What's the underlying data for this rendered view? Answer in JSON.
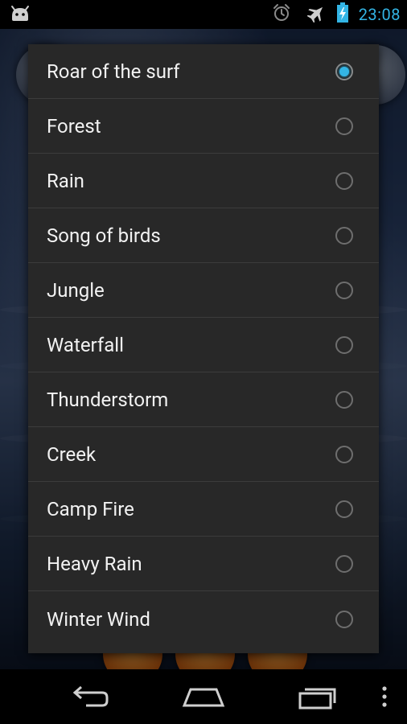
{
  "status_bar": {
    "time": "23:08",
    "icons": [
      "android-icon",
      "alarm-icon",
      "airplane-mode-icon",
      "battery-charging-icon"
    ],
    "accent_color": "#33b5e5"
  },
  "dialog": {
    "selected_index": 0,
    "options": [
      {
        "label": "Roar of the surf",
        "selected": true
      },
      {
        "label": "Forest",
        "selected": false
      },
      {
        "label": "Rain",
        "selected": false
      },
      {
        "label": "Song of birds",
        "selected": false
      },
      {
        "label": "Jungle",
        "selected": false
      },
      {
        "label": "Waterfall",
        "selected": false
      },
      {
        "label": "Thunderstorm",
        "selected": false
      },
      {
        "label": "Creek",
        "selected": false
      },
      {
        "label": "Camp Fire",
        "selected": false
      },
      {
        "label": "Heavy Rain",
        "selected": false
      },
      {
        "label": "Winter Wind",
        "selected": false
      }
    ]
  },
  "nav_bar": {
    "buttons": [
      "back-icon",
      "home-icon",
      "recent-apps-icon",
      "overflow-menu-icon"
    ]
  }
}
